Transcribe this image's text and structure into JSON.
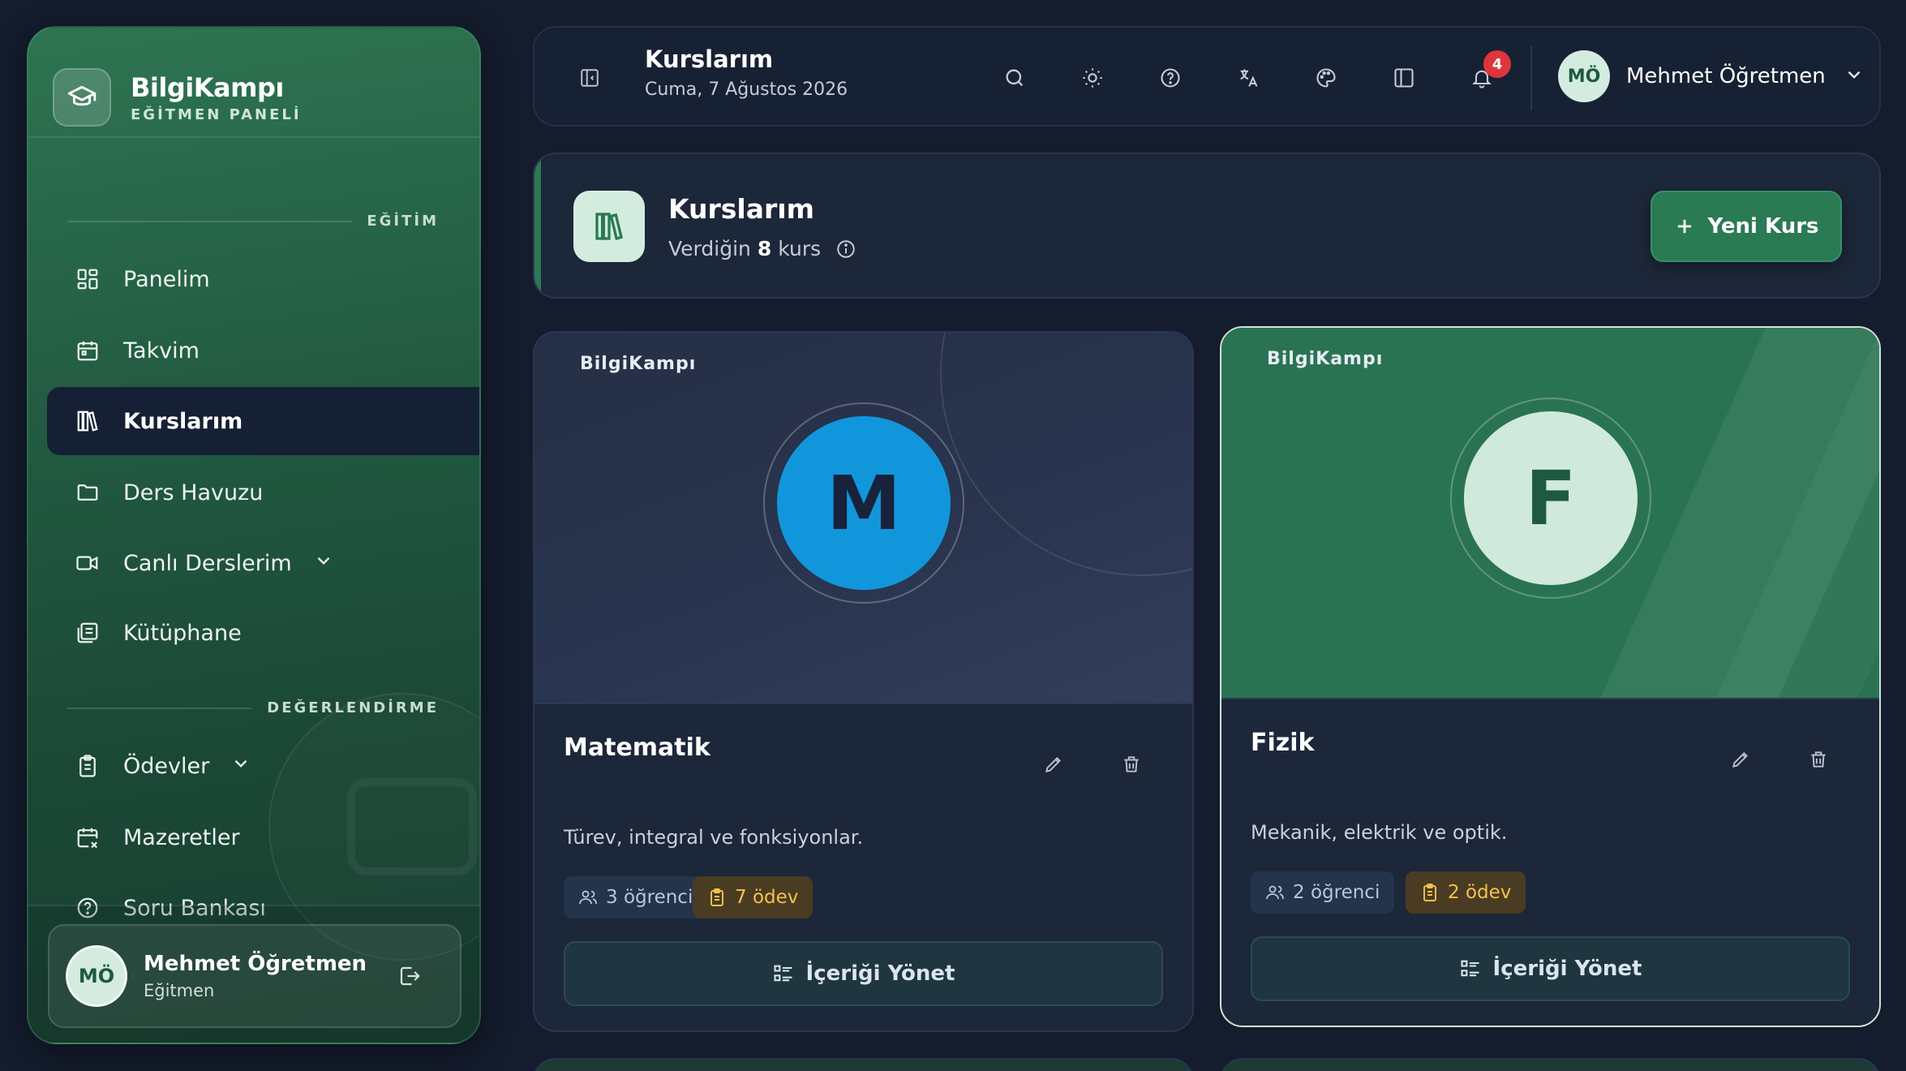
{
  "sidebar": {
    "brand_name": "BilgiKampı",
    "brand_sub": "EĞİTMEN PANELİ",
    "sections": [
      "EĞİTİM",
      "DEĞERLENDİRME"
    ],
    "items": [
      {
        "label": "Panelim",
        "icon": "dashboard-icon"
      },
      {
        "label": "Takvim",
        "icon": "calendar-icon"
      },
      {
        "label": "Kurslarım",
        "icon": "library-icon",
        "active": true
      },
      {
        "label": "Ders Havuzu",
        "icon": "folder-icon"
      },
      {
        "label": "Canlı Derslerim",
        "icon": "video-icon",
        "expandable": true
      },
      {
        "label": "Kütüphane",
        "icon": "book-icon"
      },
      {
        "label": "Ödevler",
        "icon": "clipboard-icon",
        "expandable": true
      },
      {
        "label": "Mazeretler",
        "icon": "calendar-x-icon"
      },
      {
        "label": "Soru Bankası",
        "icon": "question-circle-icon"
      }
    ],
    "user": {
      "initials": "MÖ",
      "name": "Mehmet Öğretmen",
      "role": "Eğitmen"
    }
  },
  "topbar": {
    "title": "Kurslarım",
    "date": "Cuma, 7 Ağustos 2026",
    "notification_count": "4",
    "user_initials": "MÖ",
    "user_name": "Mehmet Öğretmen"
  },
  "header": {
    "title": "Kurslarım",
    "subtitle_prefix": "Verdiğin",
    "count": "8",
    "subtitle_suffix": "kurs",
    "new_button": "Yeni Kurs"
  },
  "courses": [
    {
      "brand": "BilgiKampı",
      "letter": "M",
      "title": "Matematik",
      "description": "Türev, integral ve fonksiyonlar.",
      "students": "3 öğrenci",
      "assignments": "7 ödev",
      "manage": "İçeriği Yönet",
      "circle_color": "#1296db"
    },
    {
      "brand": "BilgiKampı",
      "letter": "F",
      "title": "Fizik",
      "description": "Mekanik, elektrik ve optik.",
      "students": "2 öğrenci",
      "assignments": "2 ödev",
      "manage": "İçeriği Yönet",
      "circle_color": "#cfe9dc"
    }
  ],
  "colors": {
    "accent_green": "#2a7a54",
    "badge_red": "#e0343b",
    "background": "#141c2d",
    "assignment_chip": "#f2c14e"
  }
}
